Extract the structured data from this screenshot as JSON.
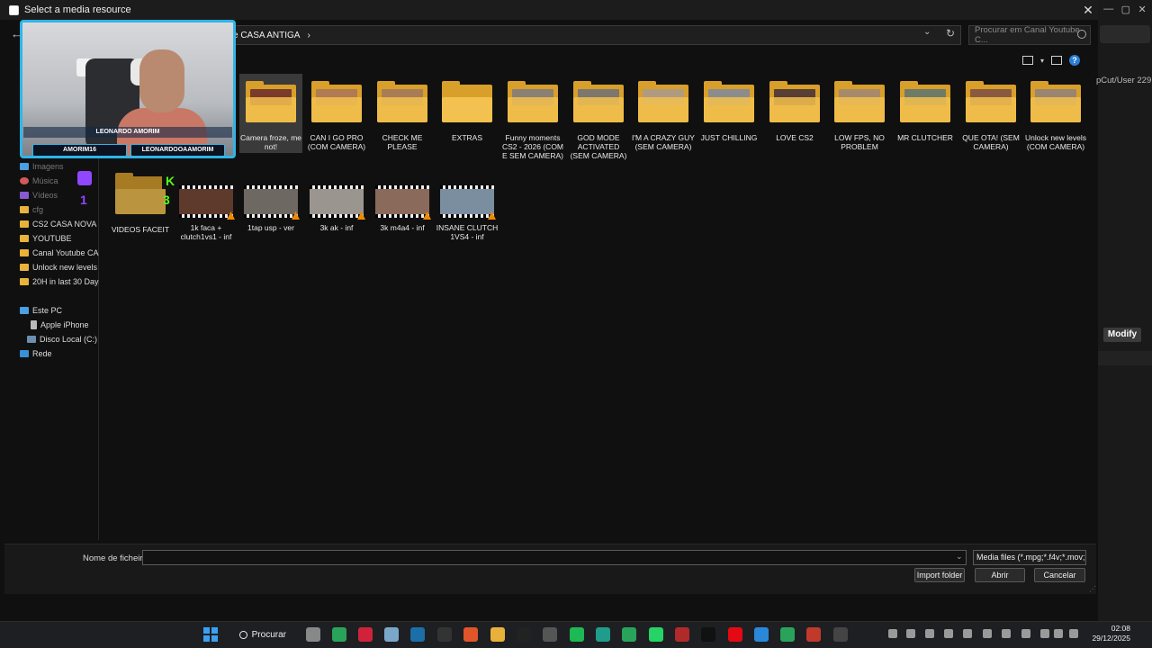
{
  "dialog": {
    "title": "Select a media resource",
    "close": "✕"
  },
  "address": {
    "crumb": "e CASA ANTIGA",
    "arrow": "›",
    "search_placeholder": "Procurar em Canal Youtube C..."
  },
  "nav": {
    "back": "←",
    "pinned": [
      "Imagens",
      "Música",
      "Vídeos",
      "cfg"
    ],
    "folders": [
      "CS2 CASA NOVA",
      "YOUTUBE",
      "Canal Youtube CASA",
      "Unlock new levels (C",
      "20H in last 30 Days (C"
    ],
    "este_pc": "Este PC",
    "devices": [
      "Apple iPhone",
      "Disco Local (C:)"
    ],
    "network": "Rede"
  },
  "folders_row": [
    {
      "label": "Camera froze, me not!",
      "pic": "#7a3b2a"
    },
    {
      "label": "CAN I GO PRO (COM CAMERA)",
      "pic": "#b07a52"
    },
    {
      "label": "CHECK ME PLEASE",
      "pic": "#a87d55"
    },
    {
      "label": "EXTRAS",
      "pic": ""
    },
    {
      "label": "Funny moments CS2 - 2026 (COM E SEM CAMERA)",
      "pic": "#8b8074"
    },
    {
      "label": "GOD MODE ACTIVATED (SEM CAMERA)",
      "pic": "#7d776e"
    },
    {
      "label": "I'M A CRAZY GUY (SEM CAMERA)",
      "pic": "#b09a80"
    },
    {
      "label": "JUST CHILLING",
      "pic": "#8c8c8c"
    },
    {
      "label": "LOVE CS2",
      "pic": "#5a3f34"
    },
    {
      "label": "LOW FPS, NO PROBLEM",
      "pic": "#a78a6a"
    },
    {
      "label": "MR CLUTCHER",
      "pic": "#6d7b67"
    },
    {
      "label": "QUE OTA! (SEM CAMERA)",
      "pic": "#8a5a40"
    },
    {
      "label": "Unlock new levels (COM CAMERA)",
      "pic": "#9a8570"
    }
  ],
  "second_row": [
    {
      "label": "VIDEOS FACEIT",
      "kind": "folder"
    },
    {
      "label": "1k faca + clutch1vs1 - inf",
      "kind": "video",
      "thumb": "#5d3a2c"
    },
    {
      "label": "1tap usp - ver",
      "kind": "video",
      "thumb": "#6e6863"
    },
    {
      "label": "3k ak - inf",
      "kind": "video",
      "thumb": "#9b9590"
    },
    {
      "label": "3k m4a4 - inf",
      "kind": "video",
      "thumb": "#8a6a5a"
    },
    {
      "label": "INSANE CLUTCH 1VS4 - inf",
      "kind": "video",
      "thumb": "#7a8ea0"
    }
  ],
  "webcam": {
    "name": "LEONARDO AMORIM",
    "tag_left": "AMORIM16",
    "tag_right": "LEONARDOOAAMORIM",
    "twitch_count": "1",
    "kick_letter": "K",
    "kick_count": "3"
  },
  "bottom": {
    "filename_label": "Nome de ficheiro:",
    "filename_value": "",
    "filter": "Media files (*.mpg;*.f4v;*.mov;",
    "import_folder": "Import folder",
    "open": "Abrir",
    "cancel": "Cancelar"
  },
  "background_app": {
    "path_text": "pCut/User 229",
    "modify": "Modify"
  },
  "taskbar": {
    "search": "Procurar",
    "time": "02:08",
    "date": "29/12/2025"
  },
  "colors": {
    "folder_back": "#d89f2a",
    "folder_front": "#f3c14f",
    "cam_border": "#2fb5e8",
    "twitch": "#9146ff",
    "kick": "#53fc18"
  }
}
